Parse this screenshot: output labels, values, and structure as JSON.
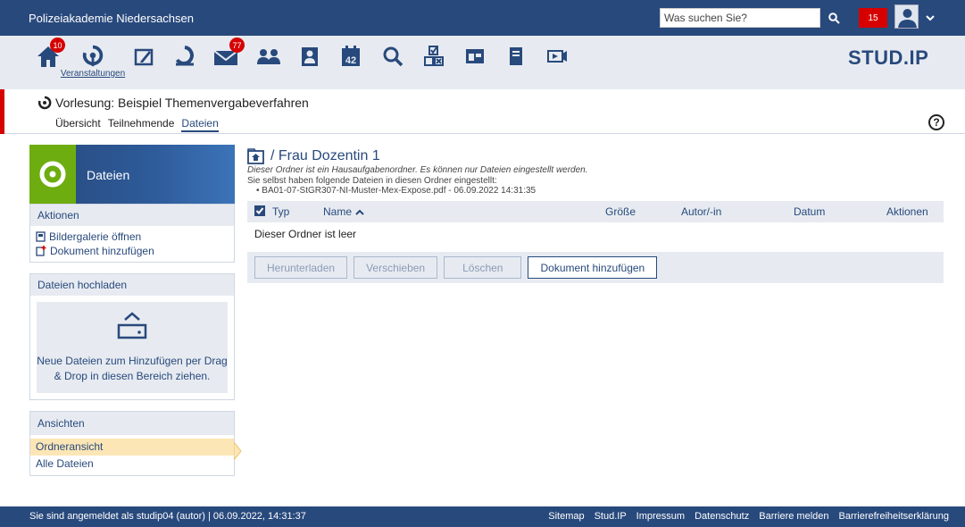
{
  "topbar": {
    "brand": "Polizeiakademie Niedersachsen",
    "search_placeholder": "Was suchen Sie?",
    "notification_count": "15"
  },
  "nav": {
    "home_badge": "10",
    "messages_badge": "77",
    "courses_label": "Veranstaltungen",
    "calendar_day": "42",
    "logo_text": "STUD.IP"
  },
  "context": {
    "title": "Vorlesung: Beispiel Themenvergabeverfahren",
    "tabs": [
      "Übersicht",
      "Teilnehmende",
      "Dateien"
    ],
    "active_tab": "Dateien"
  },
  "sidebar": {
    "title": "Dateien",
    "actions_head": "Aktionen",
    "actions": [
      "Bildergalerie öffnen",
      "Dokument hinzufügen"
    ],
    "upload_head": "Dateien hochladen",
    "upload_text": "Neue Dateien zum Hinzufügen per Drag & Drop in diesen Bereich ziehen.",
    "views_head": "Ansichten",
    "views": [
      "Ordneransicht",
      "Alle Dateien"
    ]
  },
  "main": {
    "breadcrumb": "/ Frau Dozentin 1",
    "folder_desc": "Dieser Ordner ist ein Hausaufgabenordner. Es können nur Dateien eingestellt werden.",
    "own_files_desc": "Sie selbst haben folgende Dateien in diesen Ordner eingestellt:",
    "own_file": "BA01-07-StGR307-NI-Muster-Mex-Expose.pdf - 06.09.2022 14:31:35",
    "columns": {
      "type": "Typ",
      "name": "Name",
      "size": "Größe",
      "author": "Autor/-in",
      "date": "Datum",
      "actions": "Aktionen"
    },
    "empty_text": "Dieser Ordner ist leer",
    "buttons": {
      "download": "Herunterladen",
      "move": "Verschieben",
      "delete": "Löschen",
      "add": "Dokument hinzufügen"
    }
  },
  "footer": {
    "status": "Sie sind angemeldet als studip04 (autor) | 06.09.2022, 14:31:37",
    "links": [
      "Sitemap",
      "Stud.IP",
      "Impressum",
      "Datenschutz",
      "Barriere melden",
      "Barrierefreiheitserklärung"
    ]
  },
  "colors": {
    "primary": "#28497c",
    "accent_red": "#d60000",
    "green": "#6ead10",
    "panel": "#e7ebf1",
    "selected": "#fce6b6"
  }
}
